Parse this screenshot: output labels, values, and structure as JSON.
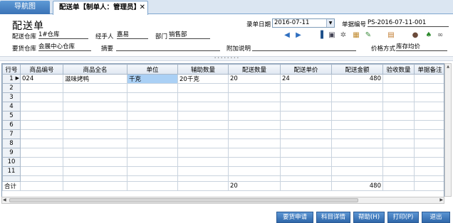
{
  "tabs": {
    "nav": "导航图",
    "active": "配送单【制单人：管理员】",
    "close": "✕"
  },
  "title": "配送单",
  "header": {
    "date_label": "录单日期",
    "date_value": "2016-07-11",
    "docno_label": "单据编号",
    "docno_value": "PS-2016-07-11-001"
  },
  "fields": {
    "warehouse_label": "配送仓库",
    "warehouse_value": "1#仓库",
    "handler_label": "经手人",
    "handler_value": "嘉易",
    "dept_label": "部门",
    "dept_value": "销售部",
    "req_wh_label": "要货仓库",
    "req_wh_value": "会展中心仓库",
    "summary_label": "摘要",
    "summary_value": "",
    "note_label": "附加说明",
    "note_value": "",
    "price_label": "价格方式",
    "price_value": "库存均价"
  },
  "icons": [
    "prev-arrow-icon",
    "next-arrow-icon",
    "chart-icon",
    "print-icon",
    "gear-icon",
    "settings-icon",
    "edit-icon",
    "package-icon",
    "user-icon",
    "leaf-icon",
    "link-icon"
  ],
  "table": {
    "headers": [
      "行号",
      "商品编号",
      "商品全名",
      "单位",
      "辅助数量",
      "配送数量",
      "配送单价",
      "配送金额",
      "验收数量",
      "单据备注"
    ],
    "rows": [
      [
        "1",
        "024",
        "滋味烤鸭",
        "千克",
        "20千克",
        "20",
        "24",
        "480",
        "",
        ""
      ],
      [
        "2",
        "",
        "",
        "",
        "",
        "",
        "",
        "",
        "",
        ""
      ],
      [
        "3",
        "",
        "",
        "",
        "",
        "",
        "",
        "",
        "",
        ""
      ],
      [
        "4",
        "",
        "",
        "",
        "",
        "",
        "",
        "",
        "",
        ""
      ],
      [
        "5",
        "",
        "",
        "",
        "",
        "",
        "",
        "",
        "",
        ""
      ],
      [
        "6",
        "",
        "",
        "",
        "",
        "",
        "",
        "",
        "",
        ""
      ],
      [
        "7",
        "",
        "",
        "",
        "",
        "",
        "",
        "",
        "",
        ""
      ],
      [
        "8",
        "",
        "",
        "",
        "",
        "",
        "",
        "",
        "",
        ""
      ],
      [
        "9",
        "",
        "",
        "",
        "",
        "",
        "",
        "",
        "",
        ""
      ],
      [
        "10",
        "",
        "",
        "",
        "",
        "",
        "",
        "",
        "",
        ""
      ],
      [
        "11",
        "",
        "",
        "",
        "",
        "",
        "",
        "",
        "",
        ""
      ]
    ],
    "total": [
      "合计",
      "",
      "",
      "",
      "",
      "20",
      "",
      "480",
      "",
      ""
    ]
  },
  "buttons": {
    "request": "要货申请",
    "detail": "科目详情",
    "help": "帮助(H)",
    "print": "打印(P)",
    "exit": "退出"
  }
}
